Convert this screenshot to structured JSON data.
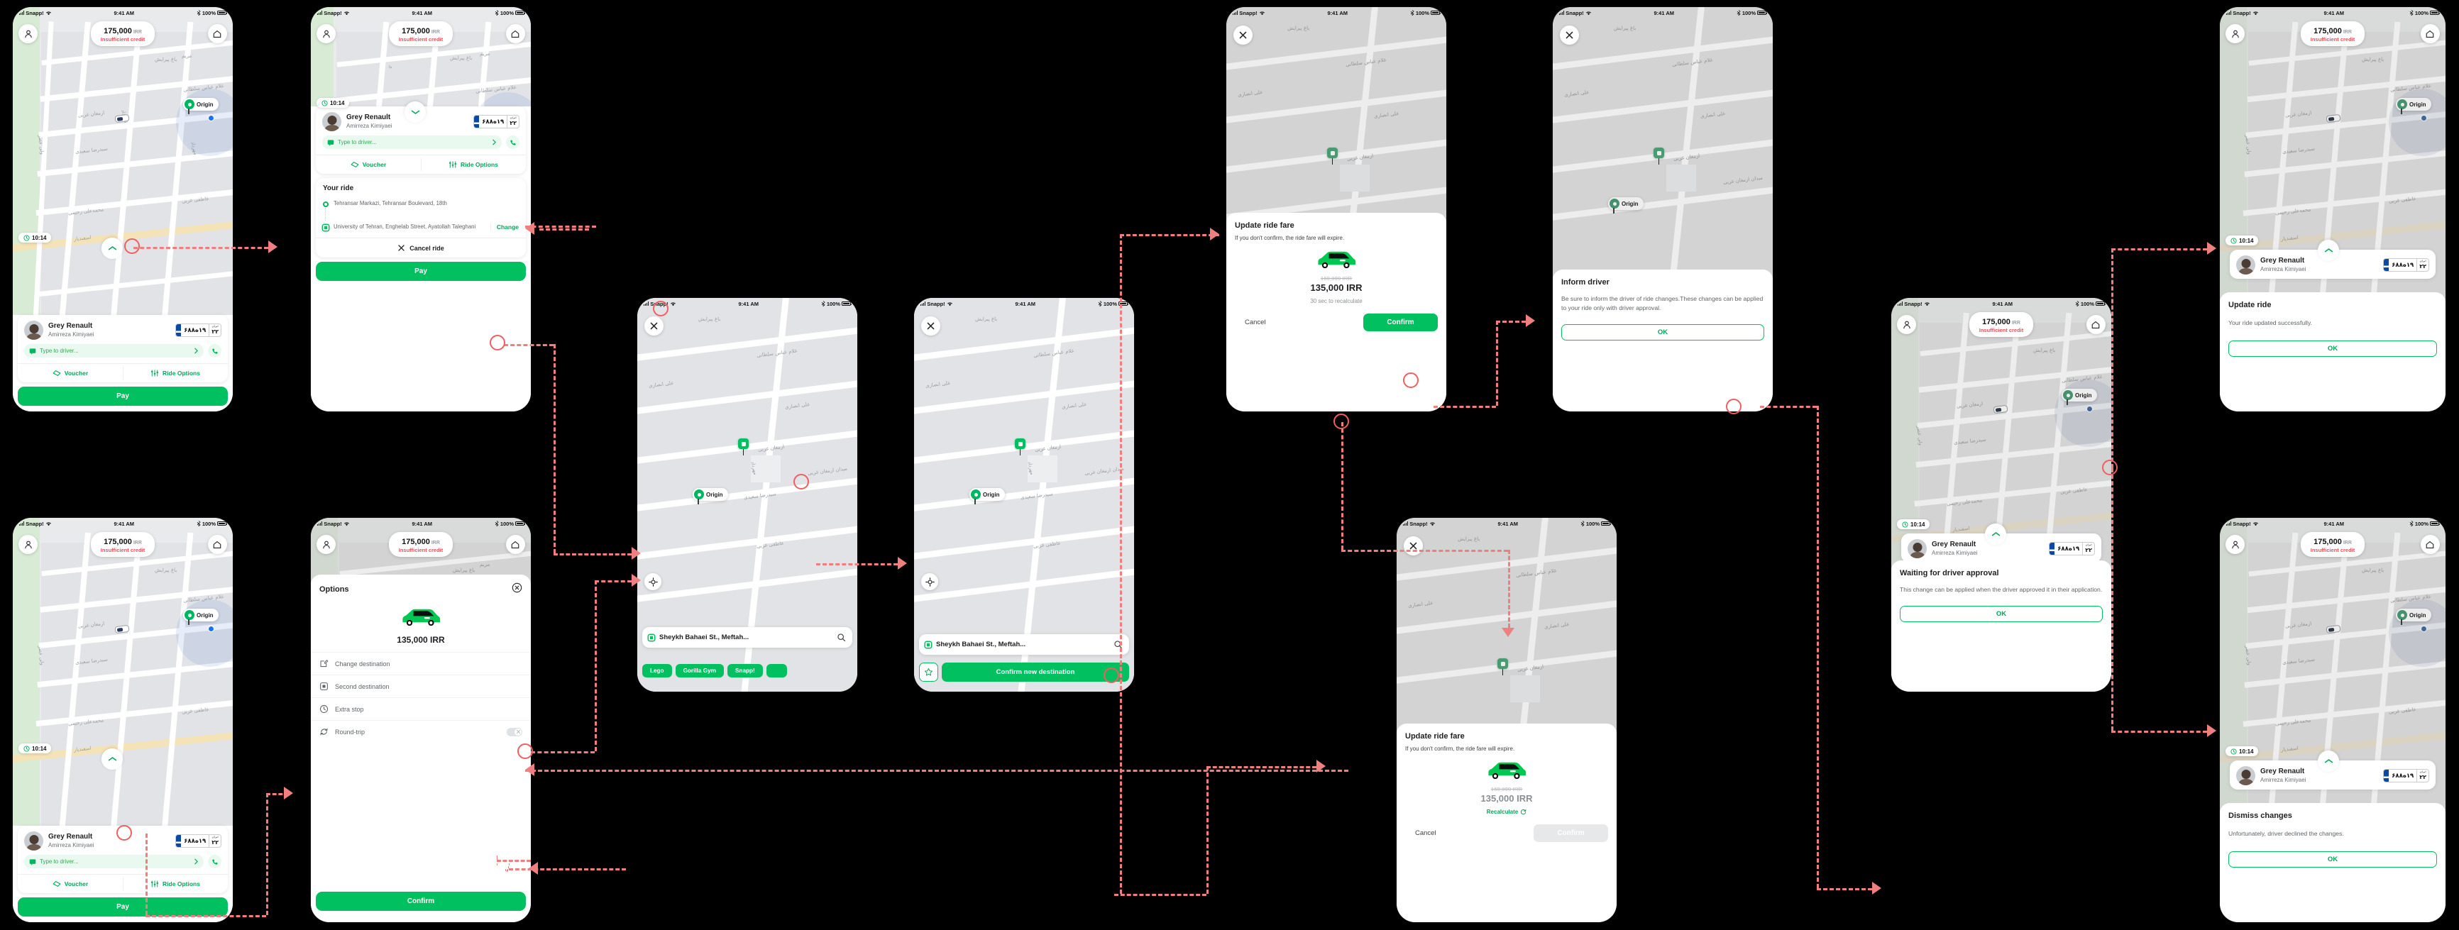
{
  "status_bar": {
    "carrier": "Snapp!",
    "time": "9:41 AM",
    "battery": "100%"
  },
  "common": {
    "credit_amount": "175,000",
    "credit_currency": "IRR",
    "credit_warning": "Insufficient credit",
    "eta": "10:14",
    "driver_car": "Grey Renault",
    "driver_name": "Amirreza Kimiyaei",
    "plate_number": "۱۹ه۶۸۸",
    "plate_city": "۲۲",
    "plate_city_label": "ایران",
    "origin_label": "Origin",
    "message_placeholder": "Type to driver...",
    "voucher_label": "Voucher",
    "ride_options_label": "Ride Options",
    "pay_label": "Pay"
  },
  "map_labels": [
    "باغ پیرایش",
    "غلام عباس سلطانی",
    "علی انصاری",
    "ارمغان غربی",
    "سیدرضا سعیدی",
    "عاطفی غربی",
    "محمدعلی رحیمی",
    "اسفندیار",
    "ولی عصر",
    "مریم",
    "مهرداد",
    "آرامش",
    "میدان ارمغان غربی"
  ],
  "panels": {
    "p1_ride_in_progress": {
      "name": "Ride in progress"
    },
    "p2_your_ride": {
      "section_title": "Your ride",
      "origin_address": "Tehransar Markazi, Tehransar Boulevard, 18th",
      "destination_address": "University of Tehran, Enghelab Street, Ayatollah Taleghani",
      "change_label": "Change",
      "cancel_label": "Cancel ride"
    },
    "p3_pick_destination": {
      "search_value": "Sheykh Bahaei St., Meftah...",
      "chips": [
        "Lego",
        "Gorilla Gym",
        "Snapp!"
      ]
    },
    "p4_confirm_destination": {
      "search_value": "Sheykh Bahaei St., Meftah...",
      "confirm_label": "Confirm new destination"
    },
    "p5_update_fare": {
      "title": "Update ride fare",
      "subtitle": "If you don't confirm, the ride fare will expire.",
      "old_price": "160,000 IRR",
      "new_price": "135,000 IRR",
      "countdown": "30 sec to recalculate",
      "cancel_label": "Cancel",
      "confirm_label": "Confirm"
    },
    "p6_inform_driver": {
      "title": "Inform driver",
      "body": "Be sure to inform the driver of ride changes.These changes can be applied to your ride only with driver approval.",
      "ok_label": "OK"
    },
    "p7_waiting_approval": {
      "title": "Waiting for driver approval",
      "body": "This change can be applied when the driver approved it in their application.",
      "ok_label": "OK"
    },
    "p8_update_ride_success": {
      "title": "Update ride",
      "body": "Your ride updated successfully.",
      "ok_label": "OK"
    },
    "p9_ride_options_tap": {
      "name": "Ride options tap"
    },
    "p10_options_sheet": {
      "title": "Options",
      "price": "135,000 IRR",
      "rows": [
        {
          "label": "Change destination",
          "icon": "edit-icon"
        },
        {
          "label": "Second destination",
          "icon": "square-icon"
        },
        {
          "label": "Extra stop",
          "icon": "clock-icon"
        },
        {
          "label": "Round-trip",
          "icon": "refresh-icon",
          "toggle": "off"
        }
      ],
      "confirm_label": "Confirm"
    },
    "p11_update_fare_expired": {
      "title": "Update ride fare",
      "subtitle": "If you don't confirm, the ride fare will expire.",
      "old_price": "160,000 IRR",
      "new_price": "135,000 IRR",
      "recalculate_label": "Recalculate",
      "cancel_label": "Cancel",
      "confirm_label": "Confirm"
    },
    "p12_dismiss_changes": {
      "title": "Dismiss changes",
      "body": "Unfortunately, driver declined the changes.",
      "ok_label": "OK"
    }
  },
  "colors": {
    "brand_green": "#00c060",
    "green_text": "#00a859",
    "warning_red": "#e8505b",
    "connector_red": "#ef7f7f",
    "map_bg": "#e9eaec"
  }
}
